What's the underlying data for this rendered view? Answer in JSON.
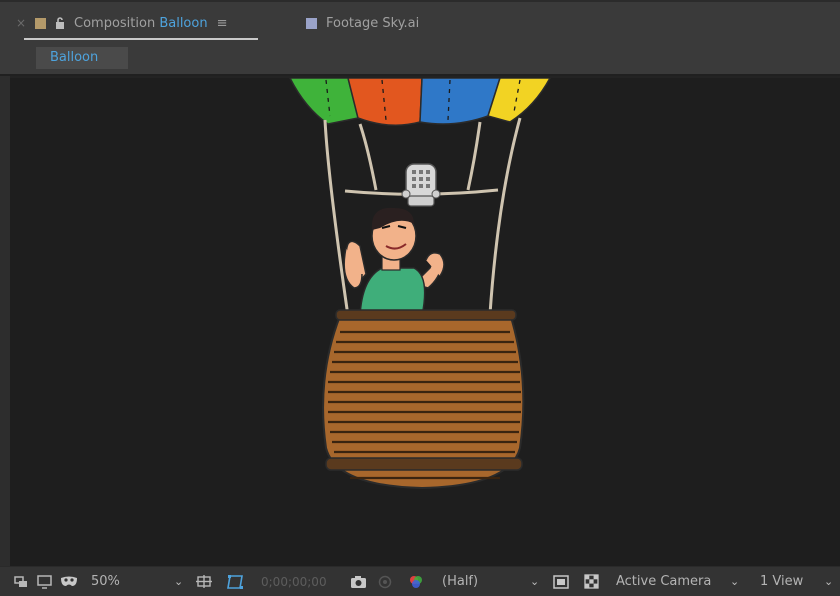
{
  "tabs": {
    "composition": {
      "prefix": "Composition",
      "name": "Balloon",
      "close": "×",
      "menu": "≡"
    },
    "footage": {
      "prefix": "Footage",
      "name": "Sky.ai"
    }
  },
  "breadcrumb": {
    "label": "Balloon"
  },
  "toolbar": {
    "magnification": "50%",
    "timecode": "0;00;00;00",
    "resolution": "(Half)",
    "camera": "Active Camera",
    "views": "1 View",
    "chevron": "⌄"
  },
  "colors": {
    "accent": "#4ea3dd",
    "balloon_green": "#3fb33a",
    "balloon_orange": "#e2571f",
    "balloon_blue": "#2f78c8",
    "balloon_yellow": "#f2d323",
    "basket": "#a8672c",
    "shirt": "#3fae7a"
  },
  "icons": {
    "close": "close-icon",
    "lock": "lock-icon",
    "menu": "panel-menu-icon",
    "toggle_view": "always-preview-icon",
    "monitor": "monitor-icon",
    "mask": "mask-visibility-icon",
    "grid": "grid-guides-icon",
    "region": "region-of-interest-icon",
    "snapshot": "camera-snapshot-icon",
    "show_snapshot": "show-snapshot-icon",
    "channels": "color-channels-icon",
    "fast_previews": "fast-previews-icon",
    "transparency": "transparency-grid-icon"
  }
}
